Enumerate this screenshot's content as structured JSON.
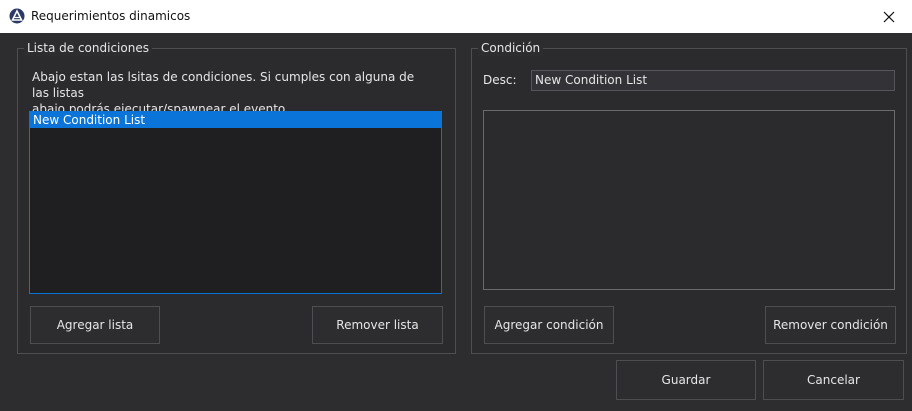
{
  "window": {
    "title": "Requerimientos dinamicos",
    "close_glyph": "✕"
  },
  "left_group": {
    "label": "Lista de condiciones",
    "description_line1": "Abajo estan las lsitas de condiciones. Si cumples con alguna de las listas",
    "description_line2": "abajo podrás ejecutar/spawnear el evento.",
    "list_items": [
      "New Condition List"
    ],
    "add_button": "Agregar lista",
    "remove_button": "Remover lista"
  },
  "right_group": {
    "label": "Condición",
    "desc_label": "Desc:",
    "desc_value": "New Condition List",
    "add_button": "Agregar condición",
    "remove_button": "Remover condición"
  },
  "footer": {
    "save_button": "Guardar",
    "cancel_button": "Cancelar"
  },
  "colors": {
    "background": "#2d2d30",
    "selection": "#0a74d8",
    "titlebar": "#ffffff"
  }
}
